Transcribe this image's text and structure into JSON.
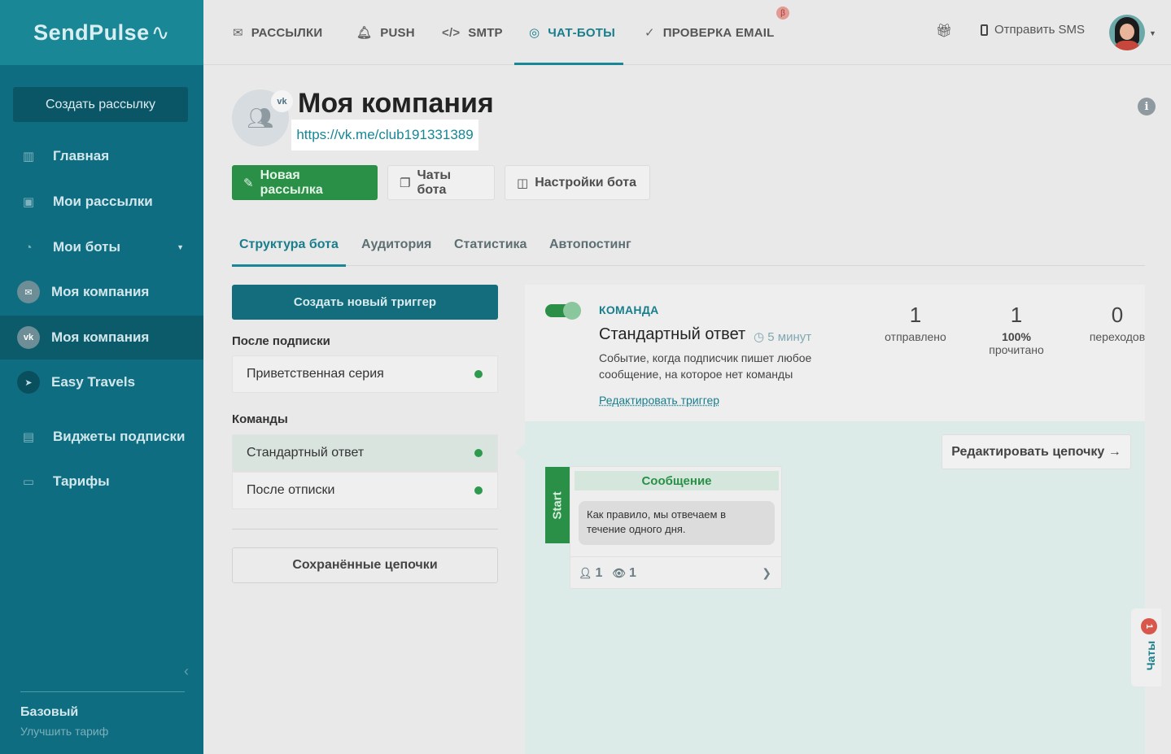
{
  "brand": {
    "name": "SendPulse",
    "accent": "#1a8797",
    "green": "#2a8f47"
  },
  "sidebar": {
    "create_button": "Создать рассылку",
    "items": [
      {
        "label": "Главная",
        "icon": "home-icon"
      },
      {
        "label": "Мои рассылки",
        "icon": "campaigns-icon"
      },
      {
        "label": "Мои боты",
        "icon": "bots-icon"
      },
      {
        "label": "Моя компания",
        "icon": "messenger-icon"
      },
      {
        "label": "Моя компания",
        "icon": "vk-icon"
      },
      {
        "label": "Easy Travels",
        "icon": "telegram-icon"
      },
      {
        "label": "Виджеты подписки",
        "icon": "widget-icon"
      },
      {
        "label": "Тарифы",
        "icon": "wallet-icon"
      }
    ],
    "plan": {
      "name": "Базовый",
      "upgrade": "Улучшить тариф"
    }
  },
  "topbar": {
    "nav": [
      {
        "label": "РАССЫЛКИ",
        "icon": "mail-icon"
      },
      {
        "label": "PUSH",
        "icon": "bell-icon"
      },
      {
        "label": "SMTP",
        "icon": "code-icon"
      },
      {
        "label": "ЧАТ-БОТЫ",
        "icon": "chat-icon"
      },
      {
        "label": "ПРОВЕРКА EMAIL",
        "icon": "check-icon"
      }
    ],
    "beta": "β",
    "sms": "Отправить SMS"
  },
  "bot": {
    "title": "Моя компания",
    "link": "https://vk.me/club191331389",
    "network_badge": "vk"
  },
  "actions": {
    "new_campaign": "Новая рассылка",
    "bot_chats": "Чаты бота",
    "bot_settings": "Настройки бота"
  },
  "tabs": [
    "Структура бота",
    "Аудитория",
    "Статистика",
    "Автопостинг"
  ],
  "left": {
    "create_trigger": "Создать новый триггер",
    "after_subscribe_label": "После подписки",
    "after_subscribe": [
      "Приветственная серия"
    ],
    "commands_label": "Команды",
    "commands": [
      "Стандартный ответ",
      "После отписки"
    ],
    "saved_chains": "Сохранённые цепочки"
  },
  "trigger": {
    "type": "КОМАНДА",
    "title": "Стандартный ответ",
    "delay": "5 минут",
    "description": "Событие, когда подписчик пишет любое сообщение, на которое нет команды",
    "edit": "Редактировать триггер",
    "stats": [
      {
        "num": "1",
        "lbl_bold": "",
        "lbl": "отправлено"
      },
      {
        "num": "1",
        "lbl_bold": "100%",
        "lbl": "прочитано"
      },
      {
        "num": "0",
        "lbl_bold": "",
        "lbl": "переходов"
      }
    ]
  },
  "chain": {
    "edit": "Редактировать цепочку →",
    "start": "Start",
    "message_title": "Сообщение",
    "message_text": "Как правило, мы отвечаем в течение одного дня.",
    "subscribers": "1",
    "views": "1"
  },
  "chats_widget": {
    "label": "Чаты",
    "count": "1"
  }
}
